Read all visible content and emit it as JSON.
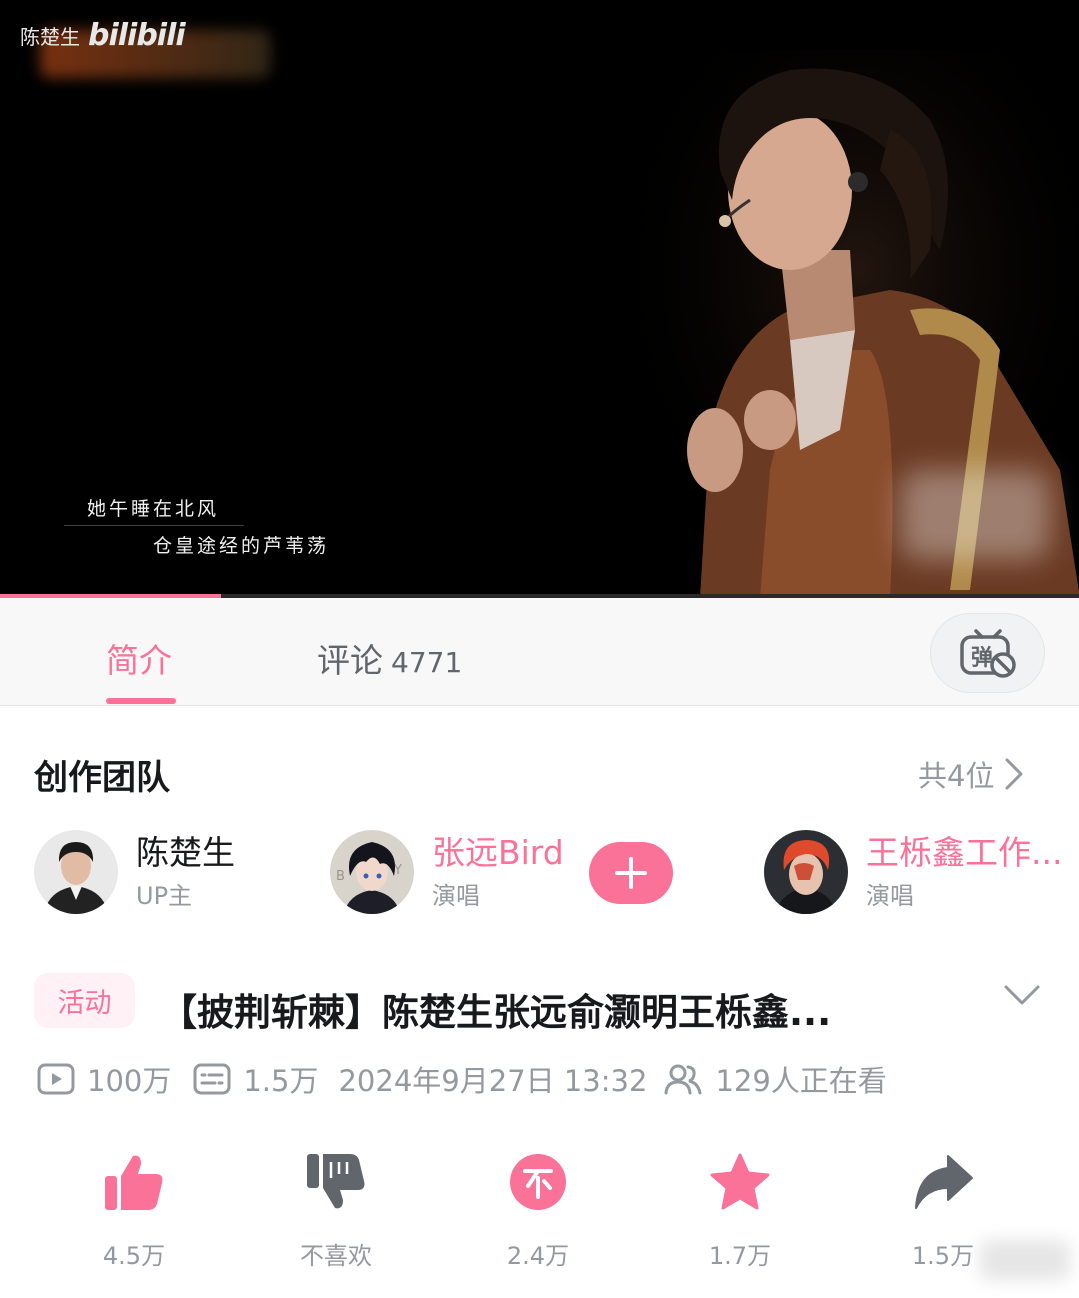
{
  "video": {
    "watermark_name": "陈楚生",
    "watermark_logo": "bilibili",
    "subtitle_line1": "她午睡在北风",
    "subtitle_line2": "仓皇途经的芦苇荡",
    "progress_fraction": 0.205
  },
  "tabs": {
    "intro_label": "简介",
    "comments_label": "评论",
    "comments_count": "4771",
    "danmaku_icon": "danmaku-off-icon"
  },
  "team": {
    "title": "创作团队",
    "count_label": "共4位",
    "members": [
      {
        "name": "陈楚生",
        "role": "UP主"
      },
      {
        "name": "张远Bird",
        "role": "演唱"
      },
      {
        "name": "王栎鑫工作...",
        "role": "演唱"
      }
    ]
  },
  "info": {
    "activity_badge": "活动",
    "title": "【披荆斩棘】陈楚生张远俞灏明王栎鑫...",
    "views": "100万",
    "danmaku_count": "1.5万",
    "publish_time": "2024年9月27日 13:32",
    "watching": "129人正在看"
  },
  "actions": {
    "like": "4.5万",
    "dislike": "不喜欢",
    "coin": "2.4万",
    "favorite": "1.7万",
    "share": "1.5万"
  },
  "colors": {
    "accent": "#fb7299",
    "secondary_text": "#9499a0",
    "icon_gray": "#61666d"
  }
}
